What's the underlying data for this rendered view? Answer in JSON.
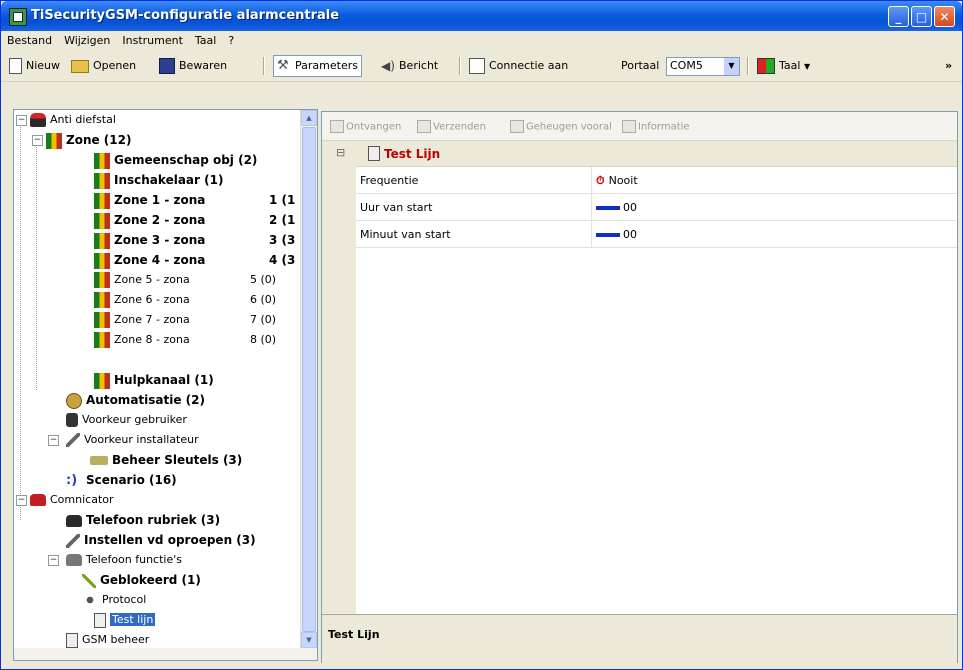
{
  "window": {
    "title": "TiSecurityGSM-configuratie  alarmcentrale",
    "min": "_",
    "max": "□",
    "close": "✕"
  },
  "menu": [
    "Bestand",
    "Wijzigen",
    "Instrument",
    "Taal",
    "?"
  ],
  "toolbar": {
    "new": "Nieuw",
    "open": "Openen",
    "save": "Bewaren",
    "parameters": "Parameters",
    "message": "Bericht",
    "connect": "Connectie aan",
    "port_label": "Portaal",
    "port_value": "COM5",
    "language": "Taal",
    "more": "»"
  },
  "tree": {
    "anti_theft": "Anti diefstal",
    "zone": "Zone (12)",
    "common_obj": "Gemeenschap obj (2)",
    "switch": "Inschakelaar (1)",
    "zones": [
      {
        "name": "Zone 1 - zona",
        "count": "1 (1"
      },
      {
        "name": "Zone 2 - zona",
        "count": "2 (1"
      },
      {
        "name": "Zone 3 - zona",
        "count": "3 (3"
      },
      {
        "name": "Zone 4 - zona",
        "count": "4 (3"
      },
      {
        "name": "Zone 5 - zona",
        "count": "5 (0)"
      },
      {
        "name": "Zone 6 - zona",
        "count": "6 (0)"
      },
      {
        "name": "Zone 7 - zona",
        "count": "7 (0)"
      },
      {
        "name": "Zone 8 - zona",
        "count": "8 (0)"
      }
    ],
    "aux": "Hulpkanaal (1)",
    "automation": "Automatisatie (2)",
    "pref_user": "Voorkeur gebruiker",
    "pref_installer": "Voorkeur installateur",
    "keys": "Beheer Sleutels (3)",
    "scenario": "Scenario (16)",
    "communicator": "Comnicator",
    "phonebook": "Telefoon rubriek (3)",
    "call_settings": "Instellen vd oproepen (3)",
    "phone_functions": "Telefoon functie's",
    "blocked": "Geblokeerd (1)",
    "protocol": "Protocol",
    "test_line": "Test lijn",
    "gsm": "GSM beheer"
  },
  "panel": {
    "tools": [
      "Ontvangen",
      "Verzenden",
      "Geheugen vooral",
      "Informatie"
    ],
    "section_title": "Test Lijn",
    "collapse": "⊟",
    "rows": [
      {
        "key": "Frequentie",
        "value": "Nooit"
      },
      {
        "key": "Uur van start",
        "value": "00"
      },
      {
        "key": "Minuut van start",
        "value": "00"
      }
    ],
    "description": "Test Lijn"
  }
}
